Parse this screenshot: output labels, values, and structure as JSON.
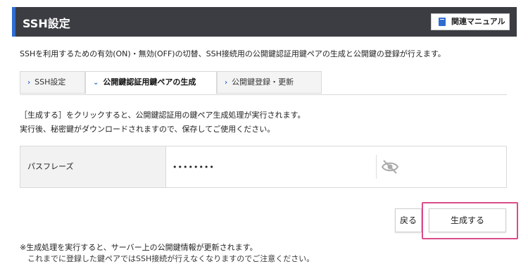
{
  "header": {
    "title": "SSH設定",
    "manual_label": "関連マニュアル"
  },
  "description": "SSHを利用するための有効(ON)・無効(OFF)の切替、SSH接続用の公開鍵認証用鍵ペアの生成と公開鍵の登録が行えます。",
  "tabs": [
    {
      "label": "SSH設定",
      "chevron": "›"
    },
    {
      "label": "公開鍵認証用鍵ペアの生成",
      "chevron": "⌄",
      "active": true
    },
    {
      "label": "公開鍵登録・更新",
      "chevron": "›"
    }
  ],
  "info": {
    "line1": "［生成する］をクリックすると、公開鍵認証用の鍵ペア生成処理が実行されます。",
    "line2": "実行後、秘密鍵がダウンロードされますので、保存してご使用ください。"
  },
  "form": {
    "passphrase_label": "パスフレーズ",
    "passphrase_value": "••••••••",
    "visibility_icon": "eye-slash-icon"
  },
  "buttons": {
    "back": "戻る",
    "generate": "生成する"
  },
  "notes": {
    "line1": "※生成処理を実行すると、サーバー上の公開鍵情報が更新されます。",
    "line2": "　これまでに登録した鍵ペアではSSH接続が行えなくなりますのでご注意ください。"
  },
  "colors": {
    "header_bg": "#3b3d42",
    "accent": "#2f6dd0",
    "highlight": "#d94c8a"
  }
}
